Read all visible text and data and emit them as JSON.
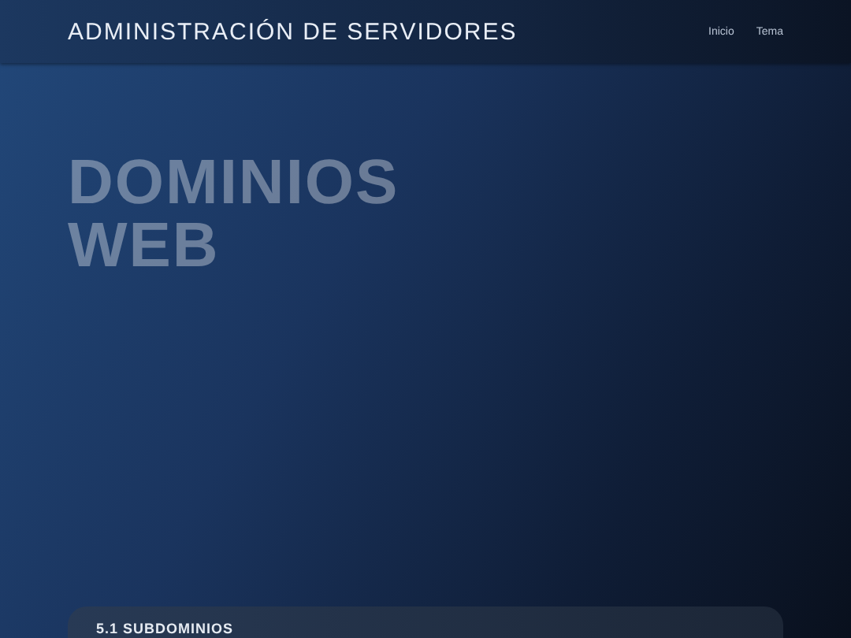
{
  "header": {
    "title": "ADMINISTRACIÓN DE SERVIDORES",
    "nav": [
      "Inicio",
      "Tema"
    ]
  },
  "hero": {
    "title_lines": [
      "DOMINIOS",
      "WEB"
    ]
  },
  "card": {
    "heading": "5.1 SUBDOMINIOS"
  }
}
